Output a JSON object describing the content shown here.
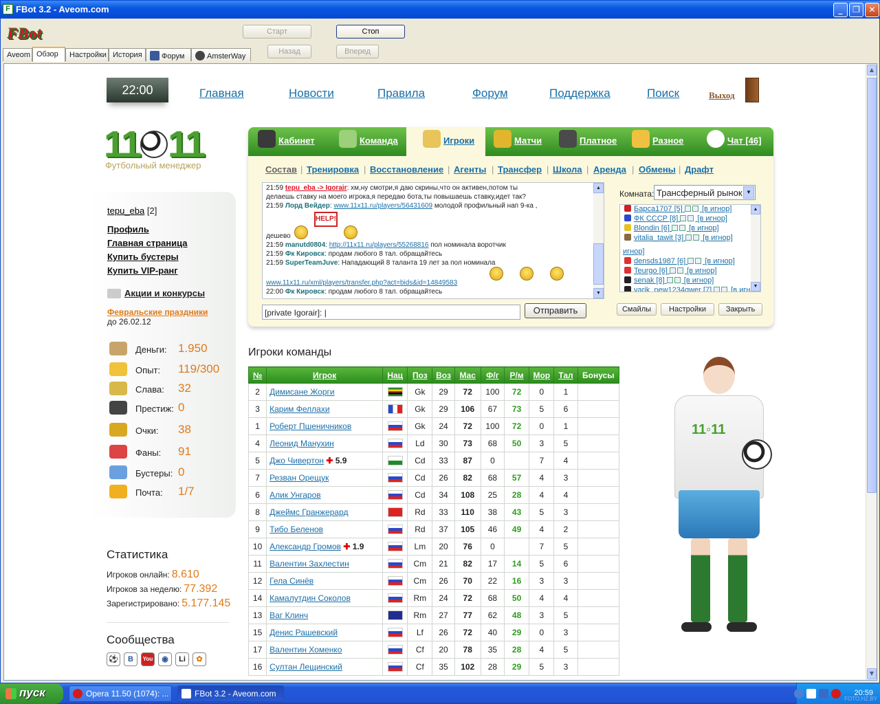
{
  "window": {
    "title": "FBot 3.2 - Aveom.com",
    "min_glyph": "_",
    "max_glyph": "❐",
    "close_glyph": "✕"
  },
  "app": {
    "logo": "FBot"
  },
  "toolbar": {
    "start": "Старт",
    "stop": "Стоп",
    "back": "Назад",
    "forward": "Вперед"
  },
  "tabs": [
    "Aveom",
    "Обзор",
    "Настройки",
    "История",
    "Форум",
    "AmsterWay"
  ],
  "site": {
    "clock": "22:00",
    "nav": [
      "Главная",
      "Новости",
      "Правила",
      "Форум",
      "Поддержка",
      "Поиск"
    ],
    "exit": "Выход",
    "logo_text_left": "11",
    "logo_text_right": "11",
    "logo_sub": "Футбольный менеджер"
  },
  "user": {
    "name": "tepu_eba",
    "level": "[2]"
  },
  "left_links": [
    "Профиль",
    "Главная страница",
    "Купить бустеры",
    "Купить VIP-ранг"
  ],
  "promo": {
    "title": "Акции и конкурсы",
    "event": "Февральские праздники",
    "until": "до 26.02.12"
  },
  "stats": [
    {
      "label": "Деньги:",
      "value": "1.950",
      "icon": "money-bag-icon",
      "color": "#c9a46a"
    },
    {
      "label": "Опыт:",
      "value": "119/300",
      "icon": "cheese-icon",
      "color": "#f0c23a"
    },
    {
      "label": "Слава:",
      "value": "32",
      "icon": "podium-icon",
      "color": "#d9b84a"
    },
    {
      "label": "Престиж:",
      "value": "0",
      "icon": "butler-icon",
      "color": "#444"
    },
    {
      "label": "Очки:",
      "value": "38",
      "icon": "trophy-icon",
      "color": "#d8a820"
    },
    {
      "label": "Фаны:",
      "value": "91",
      "icon": "fans-icon",
      "color": "#d44"
    },
    {
      "label": "Бустеры:",
      "value": "0",
      "icon": "gift-icon",
      "color": "#6aa0e0"
    },
    {
      "label": "Почта:",
      "value": "1/7",
      "icon": "envelope-icon",
      "color": "#f0b020"
    }
  ],
  "statistics": {
    "title": "Статистика",
    "rows": [
      {
        "label": "Игроков онлайн:",
        "value": "8.610"
      },
      {
        "label": "Игроков за неделю:",
        "value": "77.392"
      },
      {
        "label": "Зарегистрировано:",
        "value": "5.177.145"
      }
    ]
  },
  "communities": {
    "title": "Сообщества",
    "items": [
      "⚽",
      "В",
      "You",
      "◉",
      "Li",
      "✿"
    ]
  },
  "game_tabs": [
    "Кабинет",
    "Команда",
    "Игроки",
    "Матчи",
    "Платное",
    "Разное",
    "Чат [46]"
  ],
  "sub_nav": [
    "Состав",
    "Тренировка",
    "Восстановление",
    "Агенты",
    "Трансфер",
    "Школа",
    "Аренда",
    "Обмены",
    "Драфт"
  ],
  "chat": {
    "lines": [
      {
        "time": "21:59",
        "nick": "tepu_eba -> Igorair",
        "text": ": хм,ну смотри,я даю скрины,что он активен,потом ты"
      },
      {
        "time": "",
        "nick": "",
        "text": "делаешь ставку на моего игрока,я передаю бота,ты повышаешь ставку,идет так?"
      },
      {
        "time": "21:59",
        "nick": "Лорд Вейдер",
        "link": "www.11x11.ru/players/56431609",
        "text": "молодой профильный нап 9-ка ,"
      },
      {
        "time": "",
        "nick": "",
        "text": "дешево"
      },
      {
        "time": "21:59",
        "nick": "manutd0804",
        "link": "http://11x11.ru/players/55268816",
        "text": "пол номинала воротчик"
      },
      {
        "time": "21:59",
        "nick": "Фк Кировск",
        "text": ": продам любого 8 тал. обращайтесь"
      },
      {
        "time": "21:59",
        "nick": "SuperTeamJuve",
        "text": ": Нападающий 8 таланта 19 лет за пол номинала"
      },
      {
        "time": "",
        "nick": "",
        "link": "www.11x11.ru/xml/players/transfer.php?act=bids&id=14849583",
        "text": ""
      },
      {
        "time": "22:00",
        "nick": "Фк Кировск",
        "text": ": продам любого 8 тал. обращайтесь"
      }
    ],
    "help_sign": "HELP!",
    "input_value": "[private Igorair]:",
    "send": "Отправить",
    "room_label": "Комната:",
    "room": "Трансферный рынок",
    "users": [
      "Барса1707 [5]",
      "ФК СССР [8]",
      "Blondin [6]",
      "vitalia_tawit [3]",
      "densds1987 [6]",
      "Teurgo [6]",
      "senak [8]",
      "yarik_new1234qwer [7]"
    ],
    "ignore": "[в игнор]",
    "ignore_wrap": "игнор]",
    "buttons": [
      "Смайлы",
      "Настройки",
      "Закрыть"
    ]
  },
  "players": {
    "title": "Игроки команды",
    "headers": [
      "№",
      "Игрок",
      "Нац",
      "Поз",
      "Воз",
      "Мас",
      "Ф/г",
      "Р/м",
      "Мор",
      "Тал",
      "Бонусы"
    ],
    "rows": [
      {
        "no": "2",
        "name": "Димисане Жорги",
        "flag": "zw",
        "pos": "Gk",
        "age": "29",
        "mas": "72",
        "fg": "100",
        "rm": "72",
        "mor": "0",
        "tal": "1",
        "inj": ""
      },
      {
        "no": "3",
        "name": "Карим Феллахи",
        "flag": "fr",
        "pos": "Gk",
        "age": "29",
        "mas": "106",
        "fg": "67",
        "rm": "73",
        "mor": "5",
        "tal": "6",
        "inj": ""
      },
      {
        "no": "1",
        "name": "Роберт Пшеничников",
        "flag": "ru",
        "pos": "Gk",
        "age": "24",
        "mas": "72",
        "fg": "100",
        "rm": "72",
        "mor": "0",
        "tal": "1",
        "inj": ""
      },
      {
        "no": "4",
        "name": "Леонид Манухин",
        "flag": "ru",
        "pos": "Ld",
        "age": "30",
        "mas": "73",
        "fg": "68",
        "rm": "50",
        "mor": "3",
        "tal": "5",
        "inj": ""
      },
      {
        "no": "5",
        "name": "Джо Чивертон",
        "flag": "wa",
        "pos": "Cd",
        "age": "33",
        "mas": "87",
        "fg": "0",
        "rm": "",
        "mor": "7",
        "tal": "4",
        "inj": "5.9"
      },
      {
        "no": "7",
        "name": "Резван Орещук",
        "flag": "ru",
        "pos": "Cd",
        "age": "26",
        "mas": "82",
        "fg": "68",
        "rm": "57",
        "mor": "4",
        "tal": "3",
        "inj": ""
      },
      {
        "no": "6",
        "name": "Алик Унгаров",
        "flag": "ru",
        "pos": "Cd",
        "age": "34",
        "mas": "108",
        "fg": "25",
        "rm": "28",
        "mor": "4",
        "tal": "4",
        "inj": ""
      },
      {
        "no": "8",
        "name": "Джеймс Гранжерард",
        "flag": "ch",
        "pos": "Rd",
        "age": "33",
        "mas": "110",
        "fg": "38",
        "rm": "43",
        "mor": "5",
        "tal": "3",
        "inj": ""
      },
      {
        "no": "9",
        "name": "Тибо Беленов",
        "flag": "ru",
        "pos": "Rd",
        "age": "37",
        "mas": "105",
        "fg": "46",
        "rm": "49",
        "mor": "4",
        "tal": "2",
        "inj": ""
      },
      {
        "no": "10",
        "name": "Александр Громов",
        "flag": "ru",
        "pos": "Lm",
        "age": "20",
        "mas": "76",
        "fg": "0",
        "rm": "",
        "mor": "7",
        "tal": "5",
        "inj": "1.9"
      },
      {
        "no": "11",
        "name": "Валентин Захлестин",
        "flag": "ru",
        "pos": "Cm",
        "age": "21",
        "mas": "82",
        "fg": "17",
        "rm": "14",
        "mor": "5",
        "tal": "6",
        "inj": ""
      },
      {
        "no": "12",
        "name": "Гела Синёв",
        "flag": "ru",
        "pos": "Cm",
        "age": "26",
        "mas": "70",
        "fg": "22",
        "rm": "16",
        "mor": "3",
        "tal": "3",
        "inj": ""
      },
      {
        "no": "14",
        "name": "Камалутдин Соколов",
        "flag": "ru",
        "pos": "Rm",
        "age": "24",
        "mas": "72",
        "fg": "68",
        "rm": "50",
        "mor": "4",
        "tal": "4",
        "inj": ""
      },
      {
        "no": "13",
        "name": "Ваг Клинч",
        "flag": "au",
        "pos": "Rm",
        "age": "27",
        "mas": "77",
        "fg": "62",
        "rm": "48",
        "mor": "3",
        "tal": "5",
        "inj": ""
      },
      {
        "no": "15",
        "name": "Денис Рашевский",
        "flag": "ru",
        "pos": "Lf",
        "age": "26",
        "mas": "72",
        "fg": "40",
        "rm": "29",
        "mor": "0",
        "tal": "3",
        "inj": ""
      },
      {
        "no": "17",
        "name": "Валентин Хоменко",
        "flag": "ru",
        "pos": "Cf",
        "age": "20",
        "mas": "78",
        "fg": "35",
        "rm": "28",
        "mor": "4",
        "tal": "5",
        "inj": ""
      },
      {
        "no": "16",
        "name": "Султан Лещинский",
        "flag": "ru",
        "pos": "Cf",
        "age": "35",
        "mas": "102",
        "fg": "28",
        "rm": "29",
        "mor": "5",
        "tal": "3",
        "inj": ""
      }
    ]
  },
  "mascot_shirt": "11◦11",
  "taskbar": {
    "start": "пуск",
    "tasks": [
      "Opera 11.50 (1074): ...",
      "FBot 3.2 - Aveom.com"
    ],
    "time": "20:59",
    "watermark": "FOTO.HZ.BY"
  }
}
